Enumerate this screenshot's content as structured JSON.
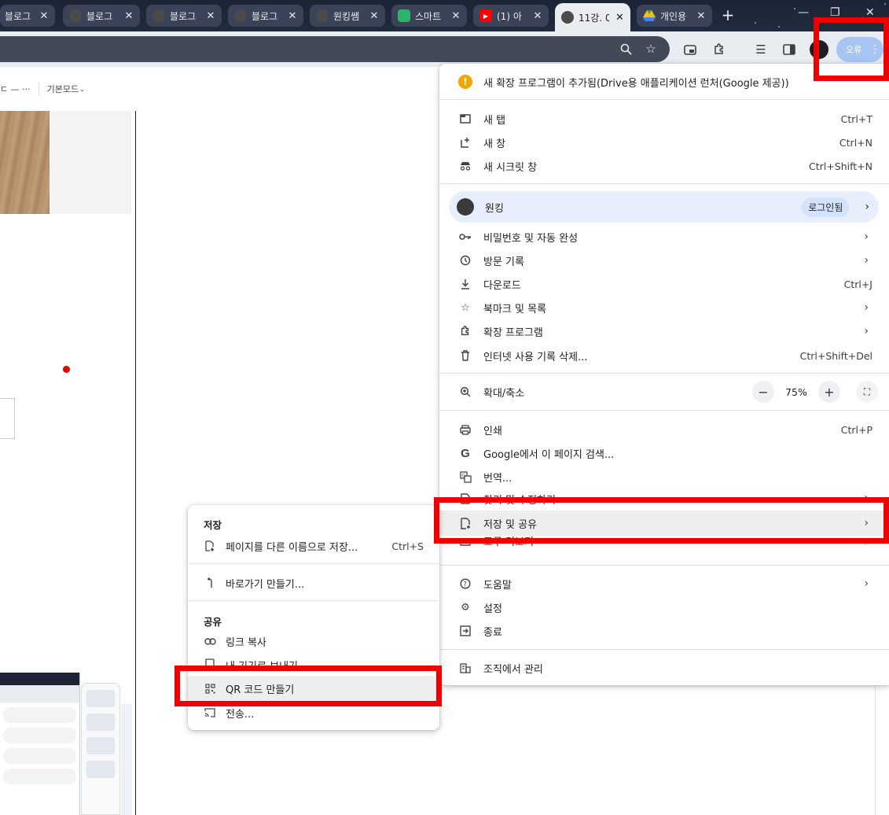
{
  "tabs": [
    {
      "title": "블로그",
      "favicon": "avatar-icon"
    },
    {
      "title": "블로그",
      "favicon": "avatar-icon"
    },
    {
      "title": "블로그",
      "favicon": "avatar-icon"
    },
    {
      "title": "블로그",
      "favicon": "avatar-icon"
    },
    {
      "title": "원킹쌤",
      "favicon": "avatar-icon"
    },
    {
      "title": "스마트",
      "favicon": "shield-icon"
    },
    {
      "title": "(1) 아",
      "favicon": "youtube-icon"
    },
    {
      "title": "11강. 0",
      "favicon": "avatar-icon",
      "active": true
    },
    {
      "title": "개인용",
      "favicon": "drive-icon"
    }
  ],
  "toolbar": {
    "profile_label": "오류",
    "new_tab_symbol": "+"
  },
  "page": {
    "mode_label": "기본모드",
    "docbar_left": "ㄷ — ···"
  },
  "menu": {
    "notice": "새 확장 프로그램이 추가됨(Drive용 애플리케이션 런처(Google 제공))",
    "new_tab": {
      "label": "새 탭",
      "shortcut": "Ctrl+T"
    },
    "new_window": {
      "label": "새 창",
      "shortcut": "Ctrl+N"
    },
    "incognito": {
      "label": "새 시크릿 창",
      "shortcut": "Ctrl+Shift+N"
    },
    "profile": {
      "name": "원킹",
      "badge": "로그인됨"
    },
    "passwords": {
      "label": "비밀번호 및 자동 완성"
    },
    "history": {
      "label": "방문 기록"
    },
    "downloads": {
      "label": "다운로드",
      "shortcut": "Ctrl+J"
    },
    "bookmarks": {
      "label": "북마크 및 목록"
    },
    "extensions": {
      "label": "확장 프로그램"
    },
    "clear_data": {
      "label": "인터넷 사용 기록 삭제...",
      "shortcut": "Ctrl+Shift+Del"
    },
    "zoom": {
      "label": "확대/축소",
      "value": "75%",
      "minus": "−",
      "plus": "+"
    },
    "print": {
      "label": "인쇄",
      "shortcut": "Ctrl+P"
    },
    "search_page": {
      "label": "Google에서 이 페이지 검색..."
    },
    "translate": {
      "label": "번역..."
    },
    "find_edit": {
      "label": "찾기 및 수정하기"
    },
    "save_share": {
      "label": "저장 및 공유"
    },
    "more_tools": {
      "label": "도구 더보기"
    },
    "help": {
      "label": "도움말"
    },
    "settings": {
      "label": "설정"
    },
    "exit": {
      "label": "종료"
    },
    "managed": {
      "label": "조직에서 관리"
    }
  },
  "submenu": {
    "save_heading": "저장",
    "save_page": {
      "label": "페이지를 다른 이름으로 저장...",
      "shortcut": "Ctrl+S"
    },
    "shortcut": {
      "label": "바로가기 만들기..."
    },
    "share_heading": "공유",
    "copy_link": {
      "label": "링크 복사"
    },
    "send_device": {
      "label": "내 기기로 보내기"
    },
    "qr_code": {
      "label": "QR 코드 만들기"
    },
    "cast": {
      "label": "전송..."
    }
  },
  "colors": {
    "highlight": "#ee0000",
    "tabstrip": "#1b2434",
    "toolbar": "#e9ecf1",
    "profile_pill": "#a8c4f2"
  }
}
